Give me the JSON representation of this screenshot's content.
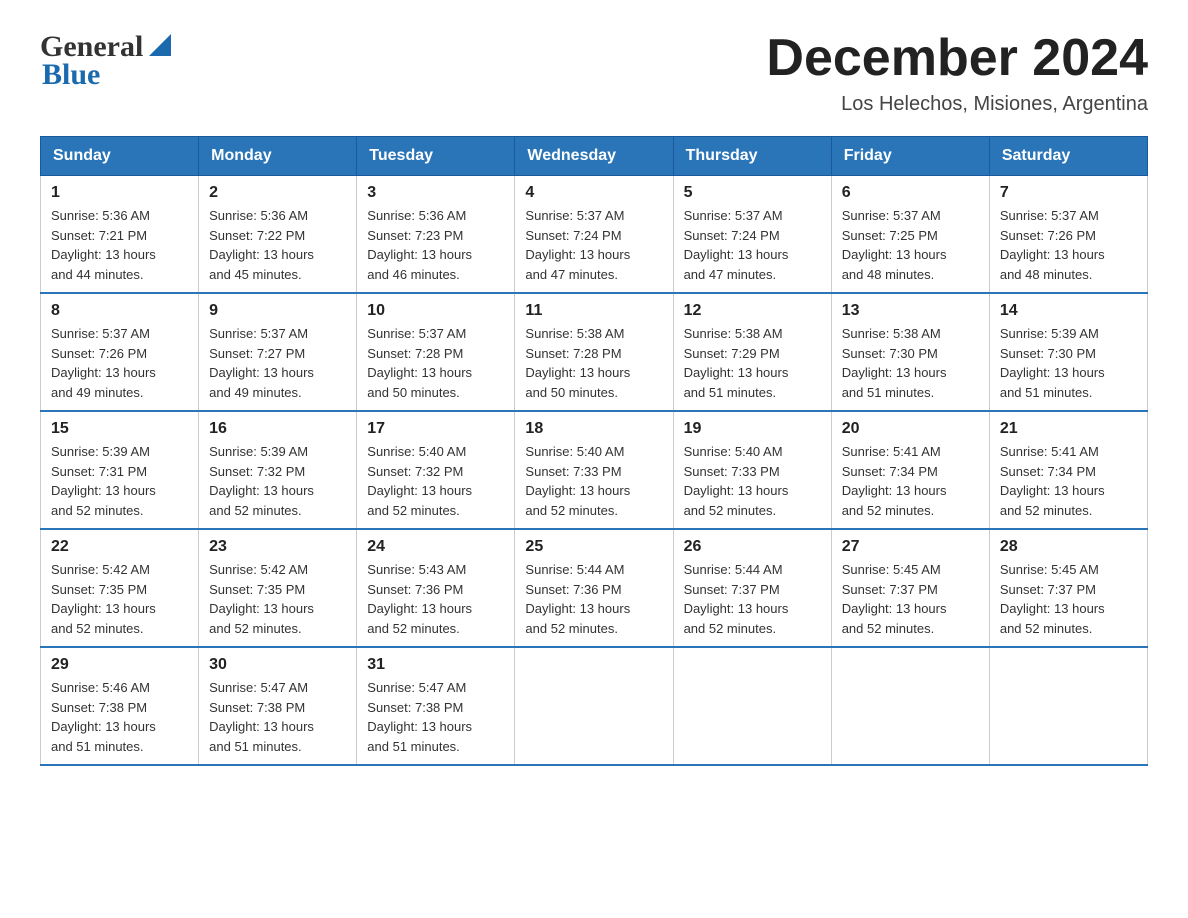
{
  "header": {
    "logo_general": "General",
    "logo_blue": "Blue",
    "title": "December 2024",
    "location": "Los Helechos, Misiones, Argentina"
  },
  "days_of_week": [
    "Sunday",
    "Monday",
    "Tuesday",
    "Wednesday",
    "Thursday",
    "Friday",
    "Saturday"
  ],
  "weeks": [
    [
      {
        "num": "1",
        "sunrise": "5:36 AM",
        "sunset": "7:21 PM",
        "daylight": "13 hours and 44 minutes."
      },
      {
        "num": "2",
        "sunrise": "5:36 AM",
        "sunset": "7:22 PM",
        "daylight": "13 hours and 45 minutes."
      },
      {
        "num": "3",
        "sunrise": "5:36 AM",
        "sunset": "7:23 PM",
        "daylight": "13 hours and 46 minutes."
      },
      {
        "num": "4",
        "sunrise": "5:37 AM",
        "sunset": "7:24 PM",
        "daylight": "13 hours and 47 minutes."
      },
      {
        "num": "5",
        "sunrise": "5:37 AM",
        "sunset": "7:24 PM",
        "daylight": "13 hours and 47 minutes."
      },
      {
        "num": "6",
        "sunrise": "5:37 AM",
        "sunset": "7:25 PM",
        "daylight": "13 hours and 48 minutes."
      },
      {
        "num": "7",
        "sunrise": "5:37 AM",
        "sunset": "7:26 PM",
        "daylight": "13 hours and 48 minutes."
      }
    ],
    [
      {
        "num": "8",
        "sunrise": "5:37 AM",
        "sunset": "7:26 PM",
        "daylight": "13 hours and 49 minutes."
      },
      {
        "num": "9",
        "sunrise": "5:37 AM",
        "sunset": "7:27 PM",
        "daylight": "13 hours and 49 minutes."
      },
      {
        "num": "10",
        "sunrise": "5:37 AM",
        "sunset": "7:28 PM",
        "daylight": "13 hours and 50 minutes."
      },
      {
        "num": "11",
        "sunrise": "5:38 AM",
        "sunset": "7:28 PM",
        "daylight": "13 hours and 50 minutes."
      },
      {
        "num": "12",
        "sunrise": "5:38 AM",
        "sunset": "7:29 PM",
        "daylight": "13 hours and 51 minutes."
      },
      {
        "num": "13",
        "sunrise": "5:38 AM",
        "sunset": "7:30 PM",
        "daylight": "13 hours and 51 minutes."
      },
      {
        "num": "14",
        "sunrise": "5:39 AM",
        "sunset": "7:30 PM",
        "daylight": "13 hours and 51 minutes."
      }
    ],
    [
      {
        "num": "15",
        "sunrise": "5:39 AM",
        "sunset": "7:31 PM",
        "daylight": "13 hours and 52 minutes."
      },
      {
        "num": "16",
        "sunrise": "5:39 AM",
        "sunset": "7:32 PM",
        "daylight": "13 hours and 52 minutes."
      },
      {
        "num": "17",
        "sunrise": "5:40 AM",
        "sunset": "7:32 PM",
        "daylight": "13 hours and 52 minutes."
      },
      {
        "num": "18",
        "sunrise": "5:40 AM",
        "sunset": "7:33 PM",
        "daylight": "13 hours and 52 minutes."
      },
      {
        "num": "19",
        "sunrise": "5:40 AM",
        "sunset": "7:33 PM",
        "daylight": "13 hours and 52 minutes."
      },
      {
        "num": "20",
        "sunrise": "5:41 AM",
        "sunset": "7:34 PM",
        "daylight": "13 hours and 52 minutes."
      },
      {
        "num": "21",
        "sunrise": "5:41 AM",
        "sunset": "7:34 PM",
        "daylight": "13 hours and 52 minutes."
      }
    ],
    [
      {
        "num": "22",
        "sunrise": "5:42 AM",
        "sunset": "7:35 PM",
        "daylight": "13 hours and 52 minutes."
      },
      {
        "num": "23",
        "sunrise": "5:42 AM",
        "sunset": "7:35 PM",
        "daylight": "13 hours and 52 minutes."
      },
      {
        "num": "24",
        "sunrise": "5:43 AM",
        "sunset": "7:36 PM",
        "daylight": "13 hours and 52 minutes."
      },
      {
        "num": "25",
        "sunrise": "5:44 AM",
        "sunset": "7:36 PM",
        "daylight": "13 hours and 52 minutes."
      },
      {
        "num": "26",
        "sunrise": "5:44 AM",
        "sunset": "7:37 PM",
        "daylight": "13 hours and 52 minutes."
      },
      {
        "num": "27",
        "sunrise": "5:45 AM",
        "sunset": "7:37 PM",
        "daylight": "13 hours and 52 minutes."
      },
      {
        "num": "28",
        "sunrise": "5:45 AM",
        "sunset": "7:37 PM",
        "daylight": "13 hours and 52 minutes."
      }
    ],
    [
      {
        "num": "29",
        "sunrise": "5:46 AM",
        "sunset": "7:38 PM",
        "daylight": "13 hours and 51 minutes."
      },
      {
        "num": "30",
        "sunrise": "5:47 AM",
        "sunset": "7:38 PM",
        "daylight": "13 hours and 51 minutes."
      },
      {
        "num": "31",
        "sunrise": "5:47 AM",
        "sunset": "7:38 PM",
        "daylight": "13 hours and 51 minutes."
      },
      null,
      null,
      null,
      null
    ]
  ],
  "labels": {
    "sunrise": "Sunrise:",
    "sunset": "Sunset:",
    "daylight": "Daylight:"
  }
}
